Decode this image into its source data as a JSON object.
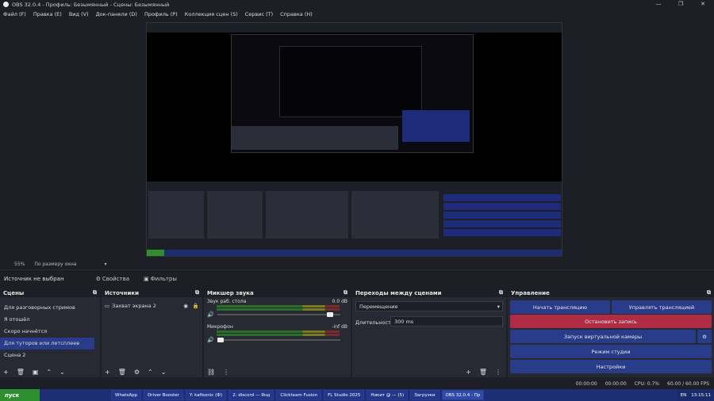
{
  "window": {
    "title": "OBS 32.0.4 - Профиль: Безымянный - Сцены: Безымянный",
    "controls": [
      "—",
      "❐",
      "✕"
    ]
  },
  "menu": [
    "Файл (F)",
    "Правка (E)",
    "Вид (V)",
    "Док-панели (D)",
    "Профиль (P)",
    "Коллекция сцен (S)",
    "Сервис (T)",
    "Справка (H)"
  ],
  "zoom": {
    "value": "55%",
    "mode": "По размеру окна"
  },
  "source_bar": {
    "no_source": "Источник не выбран",
    "properties": "Свойства",
    "filters": "Фильтры"
  },
  "scenes": {
    "title": "Сцены",
    "items": [
      "Для разговорных стримов",
      "Я отошёл",
      "Скоро начнётся",
      "Для туторов или летсплеев",
      "Сцена 2"
    ],
    "selected_index": 3
  },
  "sources": {
    "title": "Источники",
    "items": [
      {
        "name": "Захват экрана 2"
      }
    ]
  },
  "mixer": {
    "title": "Микшер звука",
    "channels": [
      {
        "name": "Звук раб. стола",
        "db": "0.0 dB",
        "level": 0.92
      },
      {
        "name": "Микрофон",
        "db": "-inf dB",
        "level": 0.03
      }
    ],
    "scale": [
      "-60",
      "-55",
      "-50",
      "-45",
      "-40",
      "-35",
      "-30",
      "-25",
      "-20",
      "-15",
      "-10",
      "-5",
      "0"
    ]
  },
  "transitions": {
    "title": "Переходы между сценами",
    "selected": "Перемещение",
    "duration_label": "Длительность",
    "duration": "300 ms"
  },
  "controls": {
    "title": "Управление",
    "start_stream": "Начать трансляцию",
    "manage_stream": "Управлять трансляцией",
    "stop_record": "Остановить запись",
    "virtual_cam": "Запуск виртуальной камеры",
    "studio_mode": "Режим студии",
    "settings": "Настройки"
  },
  "status": {
    "rec": "00:00:00",
    "stream": "00:00:00",
    "cpu": "CPU: 0.7%",
    "fps": "60.00 / 60.00 FPS"
  },
  "taskbar": {
    "start": "пуск",
    "items": [
      "WhatsApp",
      "Driver Booster",
      "Y: kafisonic (Ф)",
      "2: discord — Янд",
      "Clickteam Fusion",
      "FL Studio 2025",
      "Никит @ — (5)",
      "Загрузки",
      "OBS 32.0.4 - Пр"
    ],
    "lang": "EN",
    "time": "13:15:11"
  },
  "colors": {
    "accent": "#283c8a",
    "record": "#b02c45",
    "taskbar": "#1d2e75"
  }
}
